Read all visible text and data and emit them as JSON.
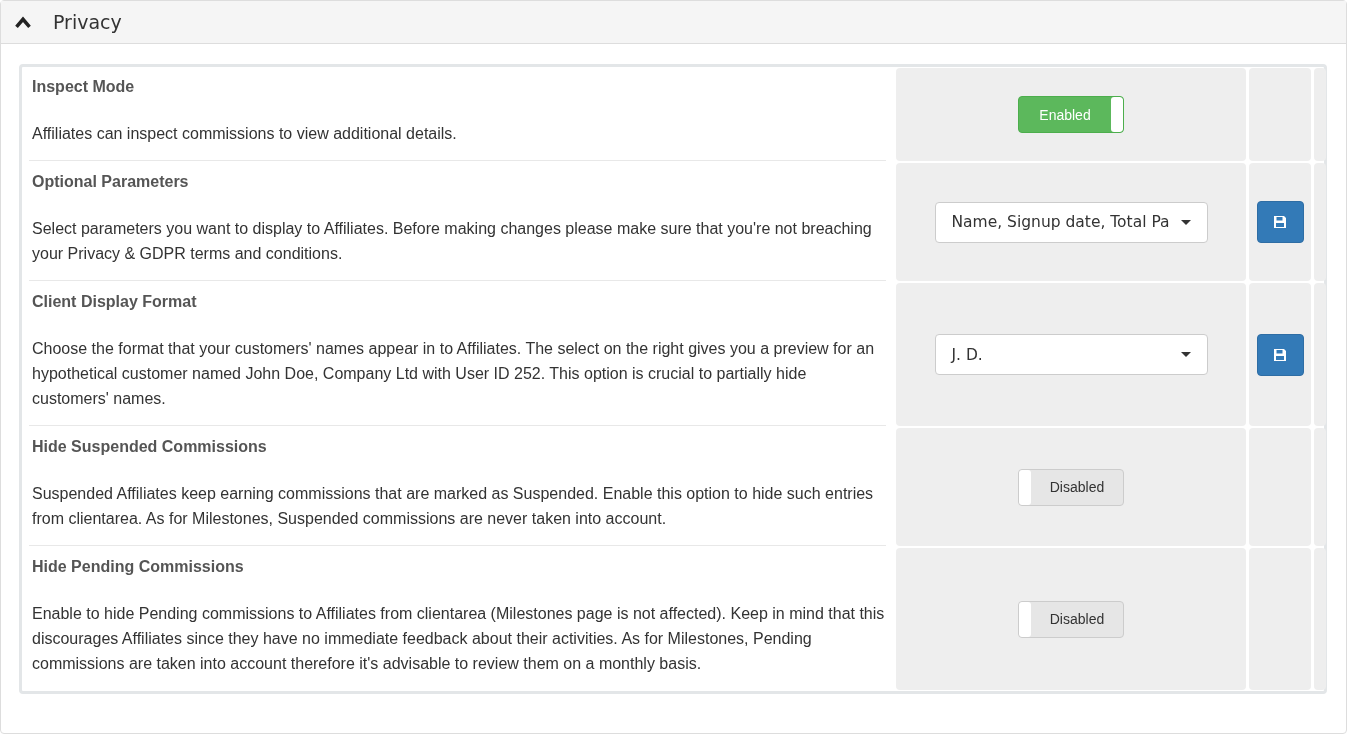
{
  "panel": {
    "title": "Privacy",
    "expanded": true
  },
  "settings": [
    {
      "kind": "toggle",
      "title": "Inspect Mode",
      "description": "Affiliates can inspect commissions to view additional details.",
      "on": true,
      "label": "Enabled"
    },
    {
      "kind": "select",
      "title": "Optional Parameters",
      "description": "Select parameters you want to display to Affiliates. Before making changes please make sure that you're not breaching your Privacy & GDPR terms and conditions.",
      "value": "Name, Signup date, Total Pa"
    },
    {
      "kind": "select",
      "title": "Client Display Format",
      "description": "Choose the format that your customers' names appear in to Affiliates. The select on the right gives you a preview for an hypothetical customer named John Doe, Company Ltd with User ID 252. This option is crucial to partially hide customers' names.",
      "value": "J. D."
    },
    {
      "kind": "toggle",
      "title": "Hide Suspended Commissions",
      "description": "Suspended Affiliates keep earning commissions that are marked as Suspended. Enable this option to hide such entries from clientarea. As for Milestones, Suspended commissions are never taken into account.",
      "on": false,
      "label": "Disabled"
    },
    {
      "kind": "toggle",
      "title": "Hide Pending Commissions",
      "description": "Enable to hide Pending commissions to Affiliates from clientarea (Milestones page is not affected). Keep in mind that this discourages Affiliates since they have no immediate feedback about their activities. As for Milestones, Pending commissions are taken into account therefore it's advisable to review them on a monthly basis.",
      "on": false,
      "label": "Disabled"
    }
  ]
}
